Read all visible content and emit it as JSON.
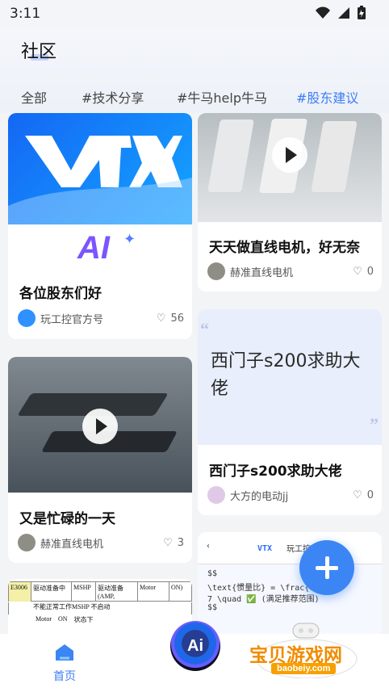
{
  "status": {
    "time": "3:11"
  },
  "page": {
    "title": "社区"
  },
  "tabs": [
    {
      "label": "全部",
      "active": false
    },
    {
      "label": "#技术分享",
      "active": false
    },
    {
      "label": "#牛马help牛马",
      "active": false
    },
    {
      "label": "#股东建议",
      "active": true
    }
  ],
  "posts": [
    {
      "title": "各位股东们好",
      "author": "玩工控官方号",
      "likes": "56"
    },
    {
      "title": "天天做直线电机，好无奈",
      "author": "赫准直线电机",
      "likes": "0"
    },
    {
      "title": "又是忙碌的一天",
      "author": "赫准直线电机",
      "likes": "3"
    },
    {
      "title": "西门子s200求助大佬",
      "author": "大方的电动jj",
      "likes": "0",
      "preview_text": "西门子s200求助大佬"
    }
  ],
  "preview_snippets": {
    "table": [
      "E3006",
      "驱动准备中",
      "MSHP",
      "驱动准备(AMP,",
      "Motor",
      "ON)",
      "不能正常工作",
      "MSHP 不启动",
      "Motor",
      "ON",
      "状态下"
    ],
    "formula": [
      "$$",
      "\\text{惯量比} = \\frac{0.000316}{0.0000",
      "7 \\quad ✅ (满足推荐范围)",
      "$$"
    ],
    "app_name": "玩工控AI"
  },
  "bottom_nav": {
    "home_label": "首页",
    "ai_label": "Ai"
  },
  "watermark": {
    "title": "宝贝游戏网",
    "url": "baobeiy.com"
  },
  "colors": {
    "accent": "#3f7cf6",
    "background": "#f3f4f6",
    "fab": "#3b86f4"
  }
}
